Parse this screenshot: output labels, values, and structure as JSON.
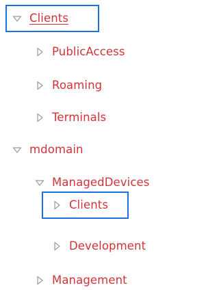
{
  "colors": {
    "label": "#d13438",
    "triangle": "#9a9a9a",
    "selection_border": "#1f6fe0"
  },
  "tree": {
    "nodes": [
      {
        "label": "Clients",
        "icon": "triangle-expanded-icon",
        "expanded": true,
        "selected": true,
        "underlined": true,
        "level": 0
      },
      {
        "label": "PublicAccess",
        "icon": "triangle-collapsed-icon",
        "expanded": false,
        "level": 1
      },
      {
        "label": "Roaming",
        "icon": "triangle-collapsed-icon",
        "expanded": false,
        "level": 1
      },
      {
        "label": "Terminals",
        "icon": "triangle-collapsed-icon",
        "expanded": false,
        "level": 1
      },
      {
        "label": "mdomain",
        "icon": "triangle-expanded-icon",
        "expanded": true,
        "level": 0
      },
      {
        "label": "ManagedDevices",
        "icon": "triangle-expanded-icon",
        "expanded": true,
        "level": 1
      },
      {
        "label": "Clients",
        "icon": "triangle-collapsed-icon",
        "expanded": false,
        "selected": true,
        "level": 2
      },
      {
        "label": "Development",
        "icon": "triangle-collapsed-icon",
        "expanded": false,
        "level": 2
      },
      {
        "label": "Management",
        "icon": "triangle-collapsed-icon",
        "expanded": false,
        "level": 1
      }
    ]
  }
}
